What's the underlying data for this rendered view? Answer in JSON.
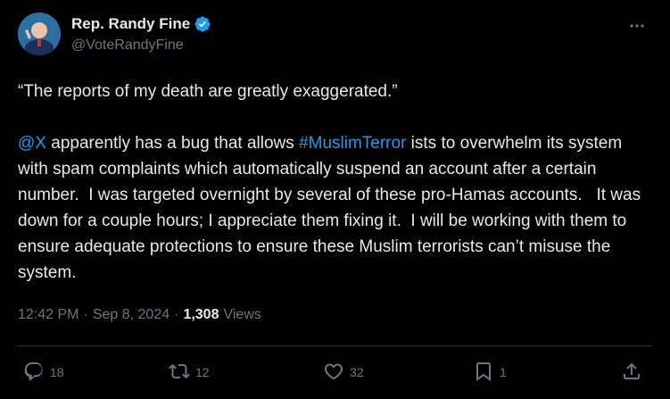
{
  "author": {
    "display_name": "Rep. Randy Fine",
    "handle": "@VoteRandyFine",
    "verified": true
  },
  "tweet": {
    "quote_line": "“The reports of my death are greatly exaggerated.”",
    "mention": "@X",
    "text_before_hashtag": " apparently has a bug that allows ",
    "hashtag": "#MuslimTerror",
    "text_after_hashtag": " ists to overwhelm its system with spam complaints which automatically suspend an account after a certain number.  I was targeted overnight by several of these pro-Hamas accounts.   It was down for a couple hours; I appreciate them fixing it.  I will be working with them to ensure adequate protections to ensure these Muslim terrorists can’t misuse the system."
  },
  "meta": {
    "time": "12:42 PM",
    "separator": "·",
    "date": "Sep 8, 2024",
    "views_count": "1,308",
    "views_label": "Views"
  },
  "actions": {
    "replies": "18",
    "reposts": "12",
    "likes": "32",
    "bookmarks": "1"
  },
  "icons": {
    "verified": "verified-badge-icon",
    "more": "more-icon",
    "reply": "reply-icon",
    "repost": "repost-icon",
    "like": "heart-icon",
    "bookmark": "bookmark-icon",
    "share": "share-icon"
  },
  "colors": {
    "background": "#000000",
    "text": "#e7e9ea",
    "secondary": "#71767b",
    "link": "#1d9bf0",
    "divider": "#2f3336"
  }
}
